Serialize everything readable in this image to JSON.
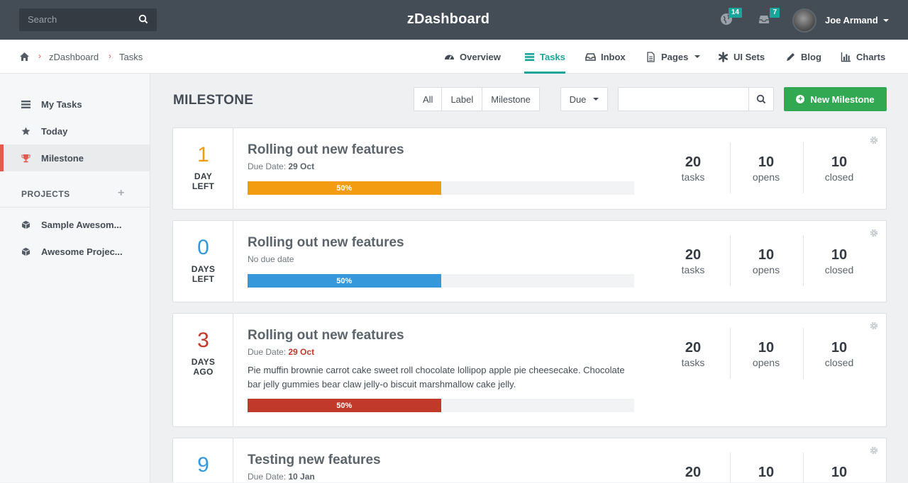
{
  "header": {
    "search_placeholder": "Search",
    "brand": "zDashboard",
    "notifications_count": "14",
    "messages_count": "7",
    "user_name": "Joe Armand"
  },
  "breadcrumb": [
    "zDashboard",
    "Tasks"
  ],
  "nav": {
    "items": [
      "Overview",
      "Tasks",
      "Inbox",
      "Pages",
      "UI Sets",
      "Blog",
      "Charts"
    ],
    "active": "Tasks"
  },
  "sidebar": {
    "items": [
      "My Tasks",
      "Today",
      "Milestone"
    ],
    "active": "Milestone",
    "projects_heading": "PROJECTS",
    "projects": [
      "Sample Awesom...",
      "Awesome Projec..."
    ]
  },
  "main": {
    "title": "MILESTONE",
    "filters": [
      "All",
      "Label",
      "Milestone"
    ],
    "due_label": "Due",
    "new_button": "New Milestone"
  },
  "milestones": [
    {
      "count": "1",
      "unit_top": "DAY",
      "unit_bottom": "LEFT",
      "title": "Rolling out new features",
      "due_prefix": "Due Date:",
      "due_value": "29 Oct",
      "progress_label": "50%",
      "progress": 0.5,
      "tasks": "20",
      "opens": "10",
      "closed": "10",
      "color": "#f39c12"
    },
    {
      "count": "0",
      "unit_top": "DAYS",
      "unit_bottom": "LEFT",
      "title": "Rolling out new features",
      "due_text": "No due date",
      "progress_label": "50%",
      "progress": 0.5,
      "tasks": "20",
      "opens": "10",
      "closed": "10",
      "color": "#3498db"
    },
    {
      "count": "3",
      "unit_top": "DAYS",
      "unit_bottom": "AGO",
      "title": "Rolling out new features",
      "due_prefix": "Due Date:",
      "due_value": "29 Oct",
      "description": "Pie muffin brownie carrot cake sweet roll chocolate lollipop apple pie cheesecake. Chocolate bar jelly gummies bear claw jelly-o biscuit marshmallow cake jelly.",
      "progress_label": "50%",
      "progress": 0.5,
      "tasks": "20",
      "opens": "10",
      "closed": "10",
      "color": "#c0392b"
    },
    {
      "count": "9",
      "title": "Testing new features",
      "due_prefix": "Due Date:",
      "due_value": "10 Jan",
      "tasks": "20",
      "opens": "10",
      "closed": "10",
      "color": "#3498db"
    }
  ],
  "stat_labels": {
    "tasks": "tasks",
    "opens": "opens",
    "closed": "closed"
  }
}
